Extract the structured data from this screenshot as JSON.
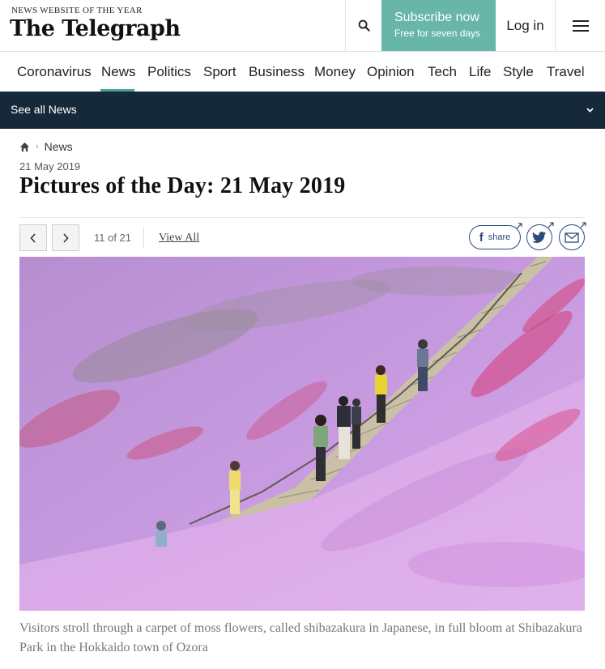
{
  "header": {
    "tagline": "NEWS WEBSITE OF THE YEAR",
    "logo": "The Telegraph",
    "subscribe_title": "Subscribe now",
    "subscribe_subtitle": "Free for seven days",
    "login_label": "Log in"
  },
  "nav": {
    "items": [
      "Coronavirus",
      "News",
      "Politics",
      "Sport",
      "Business",
      "Money",
      "Opinion",
      "Tech",
      "Life",
      "Style",
      "Travel"
    ],
    "active": "News"
  },
  "section_bar": {
    "label": "See all News"
  },
  "breadcrumb": {
    "item": "News"
  },
  "article": {
    "date": "21 May 2019",
    "title": "Pictures of the Day: 21 May 2019"
  },
  "gallery": {
    "counter": "11 of 21",
    "view_all": "View All",
    "share_label": "share",
    "caption": "Visitors stroll through a carpet of moss flowers, called shibazakura in Japanese, in full bloom at Shibazakura Park in the Hokkaido town of Ozora"
  },
  "colors": {
    "accent": "#67b6a8",
    "section_bar": "#16293a",
    "share_blue": "#2a4b7c"
  }
}
